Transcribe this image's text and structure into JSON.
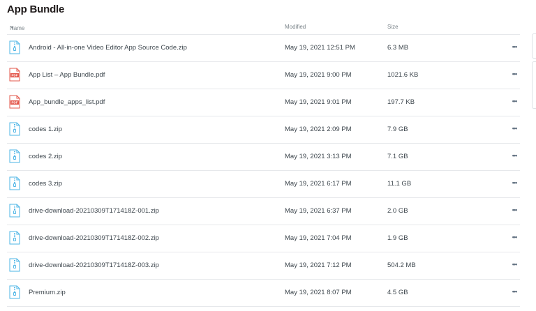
{
  "folder": {
    "title": "App Bundle"
  },
  "columns": {
    "name": "Name",
    "modified": "Modified",
    "size": "Size"
  },
  "files": [
    {
      "name": "Android - All-in-one Video Editor App Source Code.zip",
      "modified": "May 19, 2021 12:51 PM",
      "size": "6.3 MB",
      "type": "zip"
    },
    {
      "name": "App List – App Bundle.pdf",
      "modified": "May 19, 2021 9:00 PM",
      "size": "1021.6 KB",
      "type": "pdf"
    },
    {
      "name": "App_bundle_apps_list.pdf",
      "modified": "May 19, 2021 9:01 PM",
      "size": "197.7 KB",
      "type": "pdf"
    },
    {
      "name": "codes 1.zip",
      "modified": "May 19, 2021 2:09 PM",
      "size": "7.9 GB",
      "type": "zip"
    },
    {
      "name": "codes 2.zip",
      "modified": "May 19, 2021 3:13 PM",
      "size": "7.1 GB",
      "type": "zip"
    },
    {
      "name": "codes 3.zip",
      "modified": "May 19, 2021 6:17 PM",
      "size": "11.1 GB",
      "type": "zip"
    },
    {
      "name": "drive-download-20210309T171418Z-001.zip",
      "modified": "May 19, 2021 6:37 PM",
      "size": "2.0 GB",
      "type": "zip"
    },
    {
      "name": "drive-download-20210309T171418Z-002.zip",
      "modified": "May 19, 2021 7:04 PM",
      "size": "1.9 GB",
      "type": "zip"
    },
    {
      "name": "drive-download-20210309T171418Z-003.zip",
      "modified": "May 19, 2021 7:12 PM",
      "size": "504.2 MB",
      "type": "zip"
    },
    {
      "name": "Premium.zip",
      "modified": "May 19, 2021 8:07 PM",
      "size": "4.5 GB",
      "type": "zip"
    }
  ],
  "more_label": "•••",
  "pdf_badge": "PDF",
  "colors": {
    "zip_icon": "#4bb4e6",
    "pdf_icon": "#e3574b",
    "divider": "#e6e8eb"
  }
}
